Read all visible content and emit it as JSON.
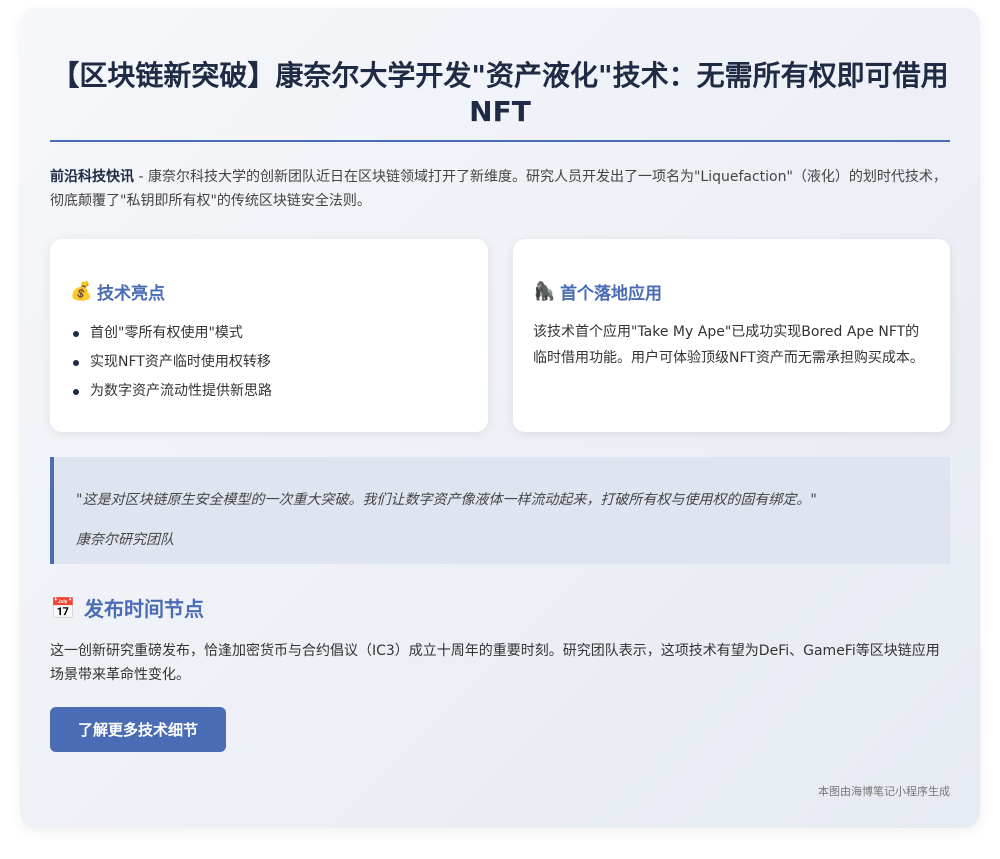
{
  "header": {
    "title": "【区块链新突破】康奈尔大学开发\"资产液化\"技术：无需所有权即可借用NFT"
  },
  "intro": {
    "lead": "前沿科技快讯",
    "text": " - 康奈尔科技大学的创新团队近日在区块链领域打开了新维度。研究人员开发出了一项名为\"Liquefaction\"（液化）的划时代技术，彻底颠覆了\"私钥即所有权\"的传统区块链安全法则。"
  },
  "highlights": {
    "icon": "💰",
    "title": "技术亮点",
    "items": [
      "首创\"零所有权使用\"模式",
      "实现NFT资产临时使用权转移",
      "为数字资产流动性提供新思路"
    ]
  },
  "application": {
    "icon": "🦍",
    "title": "首个落地应用",
    "text": "该技术首个应用\"Take My Ape\"已成功实现Bored Ape NFT的临时借用功能。用户可体验顶级NFT资产而无需承担购买成本。"
  },
  "quote": {
    "text": "\"这是对区块链原生安全模型的一次重大突破。我们让数字资产像液体一样流动起来，打破所有权与使用权的固有绑定。\"",
    "author": "康奈尔研究团队"
  },
  "timeline": {
    "icon": "📅",
    "title": "发布时间节点",
    "text": "这一创新研究重磅发布，恰逢加密货币与合约倡议（IC3）成立十周年的重要时刻。研究团队表示，这项技术有望为DeFi、GameFi等区块链应用场景带来革命性变化。"
  },
  "cta": {
    "label": "了解更多技术细节"
  },
  "footer": {
    "text": "本图由海博笔记小程序生成"
  },
  "colors": {
    "accent": "#4a6cb5",
    "title": "#1f2a44"
  }
}
